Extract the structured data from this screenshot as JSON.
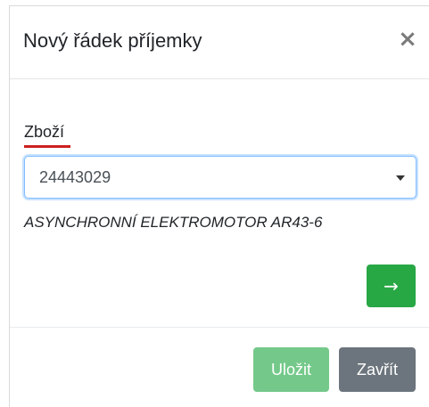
{
  "modal": {
    "title": "Nový řádek příjemky",
    "close_symbol": "×"
  },
  "form": {
    "product_label": "Zboží",
    "product_select": {
      "selected_value": "24443029"
    },
    "product_description": "ASYNCHRONNÍ ELEKTROMOTOR AR43-6",
    "next_button_symbol": "→"
  },
  "footer": {
    "save_label": "Uložit",
    "close_label": "Zavřít",
    "save_disabled": true
  },
  "colors": {
    "success": "#28a745",
    "success_disabled": "#74c98a",
    "secondary": "#6c757d",
    "label_underline": "#cc1f1f",
    "focus_border": "#80bdff"
  },
  "icons": {
    "close": "close-icon",
    "dropdown": "caret-down-icon",
    "next": "arrow-right-icon"
  }
}
